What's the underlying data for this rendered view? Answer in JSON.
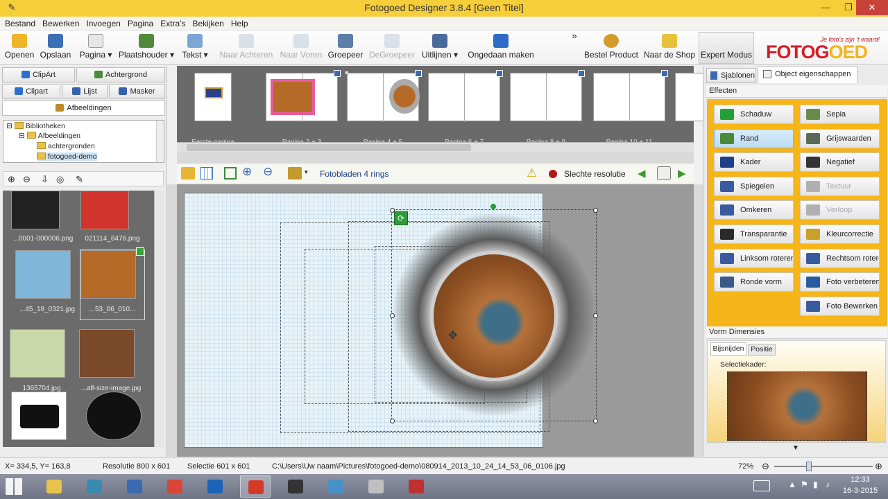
{
  "window": {
    "title": "Fotogoed Designer 3.8.4 [Geen Titel]"
  },
  "menu": [
    "Bestand",
    "Bewerken",
    "Invoegen",
    "Pagina",
    "Extra's",
    "Bekijken",
    "Help"
  ],
  "toolbar": {
    "items": [
      {
        "label": "Openen",
        "icon": "open-folder-icon",
        "color": "#f0b429",
        "enabled": true
      },
      {
        "label": "Opslaan",
        "icon": "save-disk-icon",
        "color": "#3b6fb6",
        "enabled": true
      },
      {
        "label": "Pagina",
        "icon": "page-icon",
        "color": "#e6e6e6",
        "enabled": true
      },
      {
        "label": "Plaatshouder",
        "icon": "placeholder-icon",
        "color": "#4f8b3a",
        "enabled": true
      },
      {
        "label": "Tekst",
        "icon": "text-icon",
        "color": "#7aa6d6",
        "enabled": true
      },
      {
        "label": "Naar Achteren",
        "icon": "send-back-icon",
        "color": "#9fb3c8",
        "enabled": false
      },
      {
        "label": "Naar Voren",
        "icon": "bring-front-icon",
        "color": "#9fb3c8",
        "enabled": false
      },
      {
        "label": "Groepeer",
        "icon": "group-icon",
        "color": "#5b7fa6",
        "enabled": true
      },
      {
        "label": "DeGroepeer",
        "icon": "ungroup-icon",
        "color": "#9fb3c8",
        "enabled": false
      },
      {
        "label": "Uitlijnen",
        "icon": "align-icon",
        "color": "#4a6a9a",
        "enabled": true
      },
      {
        "label": "Ongedaan maken",
        "icon": "undo-icon",
        "color": "#2e6bc4",
        "enabled": true
      },
      {
        "label": "Bestel Product",
        "icon": "globe-icon",
        "color": "#2e9a3a",
        "enabled": true
      },
      {
        "label": "Naar de Shop",
        "icon": "shop-box-icon",
        "color": "#d49a2a",
        "enabled": true
      },
      {
        "label": "Expert Modus",
        "icon": "magic-wand-icon",
        "color": "#e8c23a",
        "enabled": true
      }
    ],
    "more": "»"
  },
  "logo": {
    "tagline": "Je foto's zijn 't waard!",
    "word_a": "FOTOG",
    "word_b": "OED"
  },
  "leftpanel": {
    "tabs": [
      {
        "label": "ClipArt",
        "icon": "heart-icon",
        "color": "#2b6fd0"
      },
      {
        "label": "Achtergrond",
        "icon": "background-icon",
        "color": "#4a8a3a"
      },
      {
        "label": "Clipart",
        "icon": "heart-icon",
        "color": "#2b6fd0"
      },
      {
        "label": "Lijst",
        "icon": "frame-list-icon",
        "color": "#3461b0"
      },
      {
        "label": "Masker",
        "icon": "puzzle-mask-icon",
        "color": "#3461b0"
      },
      {
        "label": "Afbeeldingen",
        "icon": "images-icon",
        "color": "#c08a2a"
      }
    ],
    "tree": [
      {
        "label": "Bibliotheken",
        "depth": 0
      },
      {
        "label": "Afbeeldingen",
        "depth": 1
      },
      {
        "label": "achtergronden",
        "depth": 2
      },
      {
        "label": "fotogoed-demo",
        "depth": 2
      }
    ],
    "thumbs": [
      {
        "caption": "...0001-000006.png",
        "color": "#222222"
      },
      {
        "caption": "021114_8476.png",
        "color": "#d0342c"
      },
      {
        "caption": "...45_18_0321.jpg",
        "color": "#7fb6d9"
      },
      {
        "caption": "...53_06_010...",
        "color": "#b56a28"
      },
      {
        "caption": "1365704.jpg",
        "color": "#c9d8a8"
      },
      {
        "caption": "...alf-size-image.jpg",
        "color": "#7a4a2a"
      },
      {
        "caption": "",
        "color": "#1f1f1f"
      },
      {
        "caption": "",
        "color": "#111111"
      }
    ]
  },
  "pagestrip": {
    "pages": [
      {
        "label": "Eerste pagina"
      },
      {
        "label": "Pagina 2 + 3"
      },
      {
        "label": "Pagina 4 + 5"
      },
      {
        "label": "Pagina 6 + 7"
      },
      {
        "label": "Pagina 8 + 9"
      },
      {
        "label": "Pagina 10 + 11"
      },
      {
        "label": "Pa"
      }
    ]
  },
  "canvasbar": {
    "product": "Fotobladen 4 rings",
    "warning": "Slechte resolutie"
  },
  "rightpanel": {
    "tabs": [
      "Sjablonen",
      "Object eigenschappen"
    ],
    "effects_title": "Effecten",
    "effects": [
      {
        "label": "Schaduw",
        "color": "#23a035",
        "selected": false,
        "enabled": true
      },
      {
        "label": "Sepia",
        "color": "#6a8a4a",
        "selected": false,
        "enabled": true
      },
      {
        "label": "Rand",
        "color": "#4a8a3a",
        "selected": true,
        "enabled": true
      },
      {
        "label": "Grijswaarden",
        "color": "#5a6a5a",
        "selected": false,
        "enabled": true
      },
      {
        "label": "Kader",
        "color": "#1d3f8a",
        "selected": false,
        "enabled": true
      },
      {
        "label": "Negatief",
        "color": "#333333",
        "selected": false,
        "enabled": true
      },
      {
        "label": "Spiegelen",
        "color": "#3a5aa0",
        "selected": false,
        "enabled": true
      },
      {
        "label": "Textuur",
        "color": "#b0b0b0",
        "selected": false,
        "enabled": false
      },
      {
        "label": "Omkeren",
        "color": "#3a5aa0",
        "selected": false,
        "enabled": true
      },
      {
        "label": "Verloop",
        "color": "#b0b0b0",
        "selected": false,
        "enabled": false
      },
      {
        "label": "Transparantie",
        "color": "#2a2a2a",
        "selected": false,
        "enabled": true
      },
      {
        "label": "Kleurcorrectie",
        "color": "#c9a02a",
        "selected": false,
        "enabled": true
      },
      {
        "label": "Linksom roteren",
        "color": "#3a5aa0",
        "selected": false,
        "enabled": true
      },
      {
        "label": "Rechtsom roteren",
        "color": "#3a5aa0",
        "selected": false,
        "enabled": true
      },
      {
        "label": "Ronde vorm",
        "color": "#3a5a8a",
        "selected": false,
        "enabled": true
      },
      {
        "label": "Foto verbeteren",
        "color": "#2a5aa0",
        "selected": false,
        "enabled": true
      },
      {
        "label": "Foto Bewerken",
        "color": "#3a5aa0",
        "selected": false,
        "enabled": true
      }
    ],
    "dimensions_title": "Vorm Dimensies",
    "dim_tabs": [
      "Bijsnijden",
      "Positie"
    ],
    "crop_label": "Selectiekader:"
  },
  "status": {
    "coords": "X= 334,5, Y= 163,8",
    "resolution": "Resolutie 800 x 601",
    "selection": "Selectie 601 x 601",
    "path": "C:\\Users\\Uw naam\\Pictures\\fotogoed-demo\\080914_2013_10_24_14_53_06_0106.jpg",
    "zoom": "72%",
    "zoom_level": 0.72
  },
  "taskbar": {
    "time": "12:33",
    "date": "16-3-2015",
    "apps": [
      {
        "name": "explorer",
        "color": "#e8c24a"
      },
      {
        "name": "tool",
        "color": "#3a8ab0"
      },
      {
        "name": "dualview",
        "color": "#3a6ab0"
      },
      {
        "name": "chrome",
        "color": "#db4437"
      },
      {
        "name": "outlook",
        "color": "#1a64b8"
      },
      {
        "name": "fotogoed",
        "color": "#d43a2a"
      },
      {
        "name": "app7",
        "color": "#333333"
      },
      {
        "name": "network",
        "color": "#4a90c8"
      },
      {
        "name": "disc",
        "color": "#c0c0c0"
      },
      {
        "name": "app10",
        "color": "#c03030"
      }
    ]
  }
}
